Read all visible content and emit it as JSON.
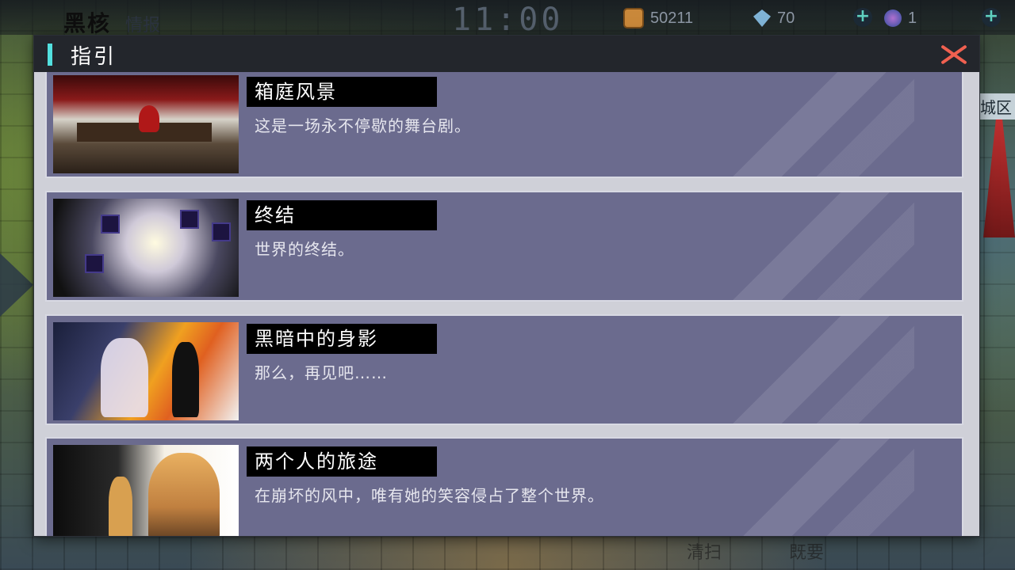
{
  "hud": {
    "logo": "黑核",
    "logo_sub": "情报",
    "clock": "11:00",
    "resources": [
      {
        "icon": "coin-icon",
        "value": "50211"
      },
      {
        "icon": "diamond-icon",
        "value": "70"
      },
      {
        "icon": "orb-icon",
        "value": "1"
      }
    ]
  },
  "background": {
    "city_tag": "央城区",
    "bottom_left": "清扫",
    "bottom_right": "既要"
  },
  "dialog": {
    "title": "指引",
    "accent_color": "#52e0df",
    "close_color": "#f06050",
    "items": [
      {
        "title": "箱庭风景",
        "desc": "这是一场永不停歇的舞台剧。"
      },
      {
        "title": "终结",
        "desc": "世界的终结。"
      },
      {
        "title": "黑暗中的身影",
        "desc": "那么，再见吧……"
      },
      {
        "title": "两个人的旅途",
        "desc": "在崩坏的风中，唯有她的笑容侵占了整个世界。"
      }
    ]
  }
}
